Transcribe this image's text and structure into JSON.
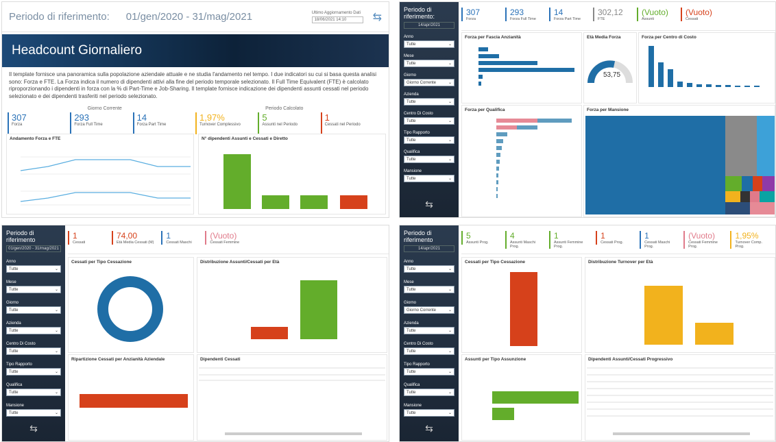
{
  "d1": {
    "period_label": "Periodo di riferimento:",
    "period_range": "01/gen/2020 - 31/mag/2021",
    "last_update_label": "Ultimo Aggiornamento Dati",
    "last_update_value": "18/06/2021 14:10",
    "banner_title": "Headcount Giornaliero",
    "description": "Il template fornisce una panoramica sulla popolazione aziendale attuale e ne studia l'andamento nel tempo. I due indicatori su cui si basa questa analisi sono: Forza e FTE. La Forza indica il numero di dipendenti attivi alla fine del periodo temporale selezionato. Il Full Time Equivalent (FTE) è calcolato riproporzionando i dipendenti in forza con la % di Part-Time e Job-Sharing. Il template fornisce indicazione dei dipendenti assunti cessati nel periodo selezionato e dei dipendenti trasferiti nel periodo selezionato.",
    "group_current": "Giorno Corrente",
    "group_period": "Periodo Calcolato",
    "kpis": [
      {
        "value": "307",
        "label": "Forza",
        "color": "#2a72b8"
      },
      {
        "value": "293",
        "label": "Forza Full Time",
        "color": "#2a72b8"
      },
      {
        "value": "14",
        "label": "Forza Part Time",
        "color": "#2a72b8"
      },
      {
        "value": "1,97%",
        "label": "Turnover Complessivo",
        "color": "#f2b21d"
      },
      {
        "value": "5",
        "label": "Assunti nel Periodo",
        "color": "#63ad2b"
      },
      {
        "value": "1",
        "label": "Cessati nel Periodo",
        "color": "#d6411b"
      }
    ],
    "chart1_title": "Andamento Forza e FTE",
    "chart2_title": "N° dipendenti Assunti e Cessati e Diretto"
  },
  "d2": {
    "period_label": "Periodo di riferimento:",
    "period_range": "14/apr/2021",
    "filters": [
      "Anno",
      "Mese",
      "Giorno",
      "Azienda",
      "Centro Di Costo",
      "Tipo Rapporto",
      "Qualifica",
      "Mansione"
    ],
    "filter_values": [
      "Tutte",
      "Tutte",
      "Giorno Corrente",
      "Tutte",
      "Tutte",
      "Tutte",
      "Tutte",
      "Tutte"
    ],
    "kpis": [
      {
        "value": "307",
        "label": "Forza",
        "color": "#2a72b8"
      },
      {
        "value": "293",
        "label": "Forza Full Time",
        "color": "#2a72b8"
      },
      {
        "value": "14",
        "label": "Forza Part Time",
        "color": "#2a72b8"
      },
      {
        "value": "302,12",
        "label": "FTE",
        "color": "#888888"
      },
      {
        "value": "(Vuoto)",
        "label": "Assunti",
        "color": "#63ad2b"
      },
      {
        "value": "(Vuoto)",
        "label": "Cessati",
        "color": "#d6411b"
      }
    ],
    "chart_titles": [
      "Forza per Fascia Anzianità",
      "Età Media Forza",
      "Forza per Centro di Costo",
      "Forza per Qualifica",
      "Forza per Mansione"
    ],
    "gauge_value": "53,75"
  },
  "d3": {
    "period_label": "Periodo di riferimento",
    "period_range": "01/gen/2020 - 31/mag/2021",
    "filters": [
      "Anno",
      "Mese",
      "Giorno",
      "Azienda",
      "Centro Di Costo",
      "Tipo Rapporto",
      "Qualifica",
      "Mansione"
    ],
    "filter_values": [
      "Tutte",
      "Tutte",
      "Tutte",
      "Tutte",
      "Tutte",
      "Tutte",
      "Tutte",
      "Tutte"
    ],
    "kpis": [
      {
        "value": "1",
        "label": "Cessati",
        "color": "#d6411b"
      },
      {
        "value": "74,00",
        "label": "Età Media Cessati (M)",
        "color": "#d6411b"
      },
      {
        "value": "1",
        "label": "Cessati Maschi",
        "color": "#2a72b8"
      },
      {
        "value": "(Vuoto)",
        "label": "Cessati Femmine",
        "color": "#e07a8a"
      }
    ],
    "chart_titles": [
      "Cessati per Tipo Cessazione",
      "Distribuzione Assunti/Cessati per Età",
      "Ripartizione Cessati per Anzianità Aziendale",
      "Dipendenti Cessati"
    ]
  },
  "d4": {
    "period_label": "Periodo di riferimento",
    "period_range": "14/apr/2021",
    "filters": [
      "Anno",
      "Mese",
      "Giorno",
      "Azienda",
      "Centro Di Costo",
      "Tipo Rapporto",
      "Qualifica",
      "Mansione"
    ],
    "filter_values": [
      "Tutte",
      "Tutte",
      "Giorno Corrente",
      "Tutte",
      "Tutte",
      "Tutte",
      "Tutte",
      "Tutte"
    ],
    "kpis": [
      {
        "value": "5",
        "label": "Assunti Prog.",
        "color": "#63ad2b"
      },
      {
        "value": "4",
        "label": "Assunti Maschi Prog.",
        "color": "#63ad2b"
      },
      {
        "value": "1",
        "label": "Assunti Femmine Prog.",
        "color": "#63ad2b"
      },
      {
        "value": "1",
        "label": "Cessati Prog.",
        "color": "#d6411b"
      },
      {
        "value": "1",
        "label": "Cessati Maschi Prog.",
        "color": "#2a72b8"
      },
      {
        "value": "(Vuoto)",
        "label": "Cessati Femmine Prog.",
        "color": "#e07a8a"
      },
      {
        "value": "1,95%",
        "label": "Turnover Comp. Prog.",
        "color": "#f2b21d"
      }
    ],
    "chart_titles": [
      "Cessati per Tipo Cessazione",
      "Distribuzione Turnover per Età",
      "Assunti per Tipo Assunzione",
      "Dipendenti Assunti/Cessati Progressivo"
    ]
  },
  "dropdown_value": "Tutte"
}
